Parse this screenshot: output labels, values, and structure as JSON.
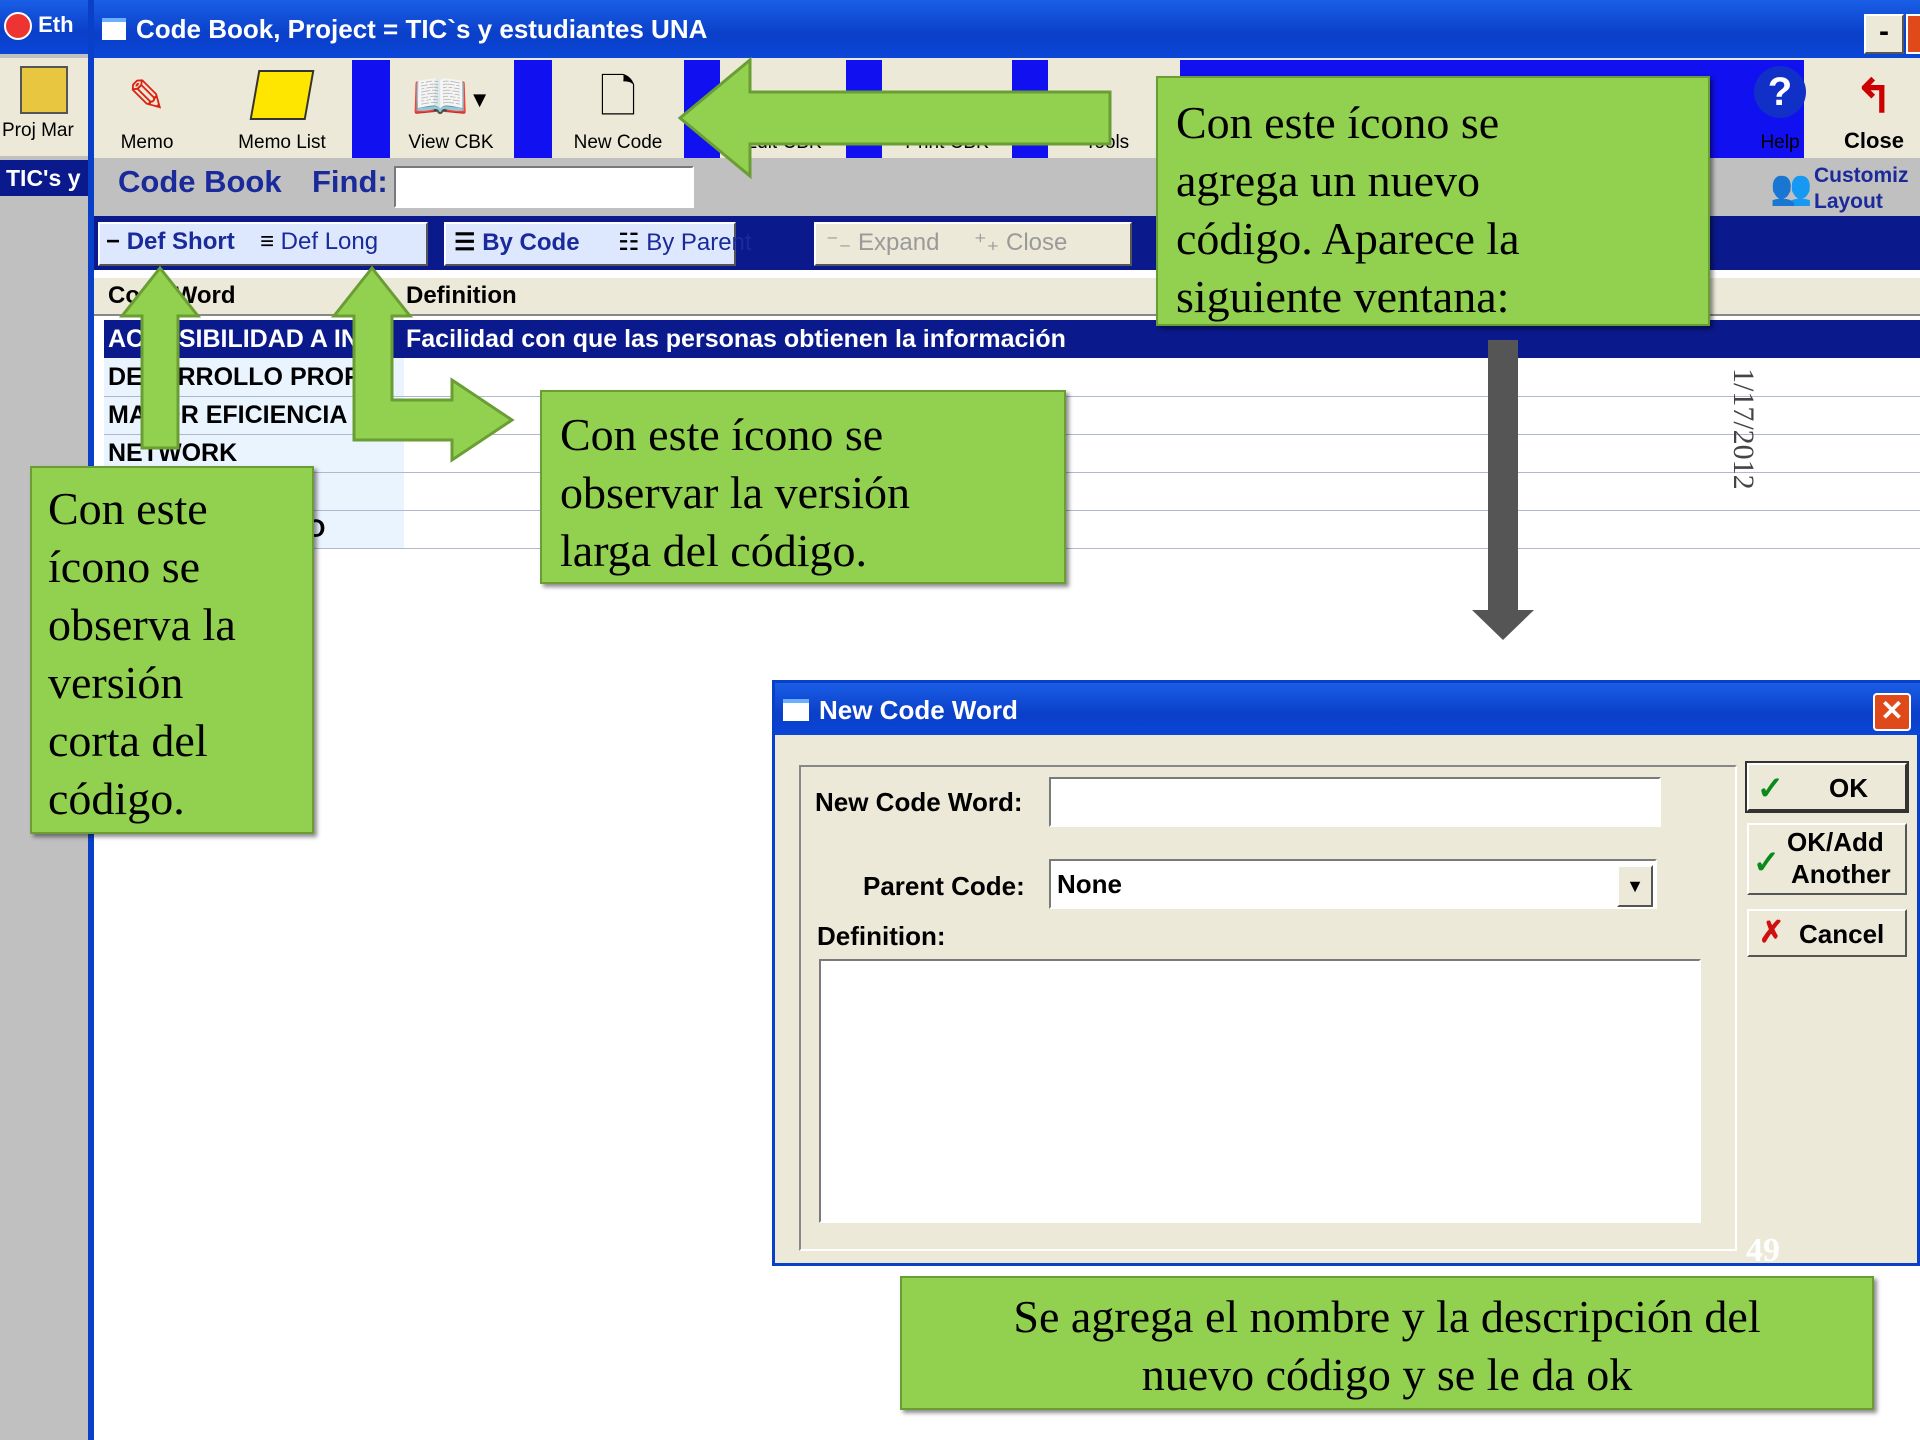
{
  "bg_app": {
    "short_title": "Eth",
    "proj_label": "Proj Mar",
    "tab_label": "TIC's y"
  },
  "window": {
    "title": "Code Book, Project = TIC`s y estudiantes UNA",
    "min_label": "-"
  },
  "toolbar": {
    "memo": "Memo",
    "memo_list": "Memo List",
    "view_cbk": "View CBK",
    "new_code": "New Code",
    "edit_cbk": "Edit CBK",
    "print_cbk": "Print CBK",
    "tools": "Tools",
    "help": "Help",
    "close": "Close"
  },
  "findbar": {
    "title": "Code Book",
    "find_label": "Find:",
    "find_value": "",
    "customize": "Customiz",
    "layout": "Layout"
  },
  "viewbar": {
    "def_short": "Def Short",
    "def_long": "Def Long",
    "by_code": "By Code",
    "by_parent": "By Parent",
    "expand": "Expand",
    "close": "Close"
  },
  "table": {
    "headers": [
      "Code Word",
      "Definition"
    ],
    "rows": [
      {
        "code": "ACCESIBILIDAD A IN",
        "definition": "Facilidad con que las personas obtienen la información"
      },
      {
        "code": "DESARROLLO PROF",
        "definition": ""
      },
      {
        "code": "MAYOR EFICIENCIA",
        "definition": ""
      },
      {
        "code": "NETWORK",
        "definition": ""
      },
      {
        "code": "",
        "definition": ""
      },
      {
        "code": "O",
        "definition": ""
      }
    ]
  },
  "dialog": {
    "title": "New Code Word",
    "code_label": "New Code Word:",
    "code_value": "",
    "parent_label": "Parent Code:",
    "parent_value": "None",
    "definition_label": "Definition:",
    "definition_value": "",
    "ok": "OK",
    "ok_add_1": "OK/Add",
    "ok_add_2": "Another",
    "cancel": "Cancel"
  },
  "callouts": {
    "new_code": [
      "Con este ícono se",
      "agrega un nuevo",
      "código. Aparece la",
      "siguiente ventana:"
    ],
    "def_long": [
      "Con este ícono se",
      "observar la versión",
      "larga del código."
    ],
    "def_short": [
      "Con este",
      "ícono se",
      "observa la",
      "versión",
      "corta del",
      "código."
    ],
    "bottom": [
      "Se agrega el nombre y la descripción del",
      "nuevo código y se le da ok"
    ]
  },
  "slide": {
    "date": "1/17/2012",
    "page": "49"
  },
  "colors": {
    "callout": "#92d050",
    "title_blue": "#0a3fc8",
    "selected_row": "#0a1a8c",
    "accent_blue": "#1010f0"
  }
}
